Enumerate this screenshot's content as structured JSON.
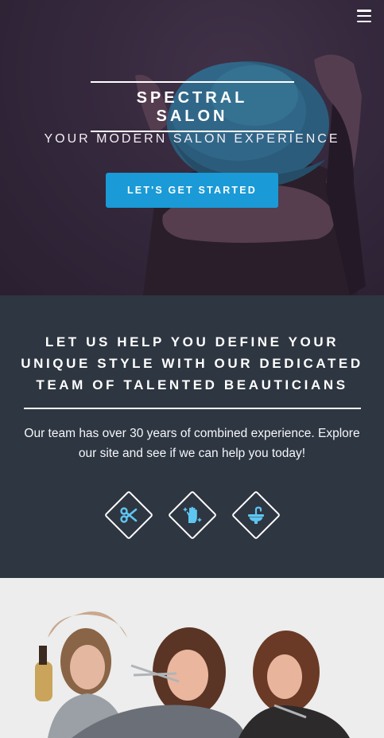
{
  "hero": {
    "title": "SPECTRAL SALON",
    "tagline": "YOUR MODERN SALON EXPERIENCE",
    "cta_label": "LET'S GET STARTED",
    "menu_icon": "hamburger-menu-icon"
  },
  "intro": {
    "heading": "LET US HELP YOU DEFINE YOUR UNIQUE STYLE WITH OUR DEDICATED TEAM OF TALENTED BEAUTICIANS",
    "body": "Our team has over 30 years of combined experience. Explore our site and see if we can help you today!",
    "services": [
      {
        "icon": "scissors-icon"
      },
      {
        "icon": "hand-sparkle-icon"
      },
      {
        "icon": "wash-sink-icon"
      }
    ]
  },
  "colors": {
    "accent": "#1a9ad6",
    "dark_panel": "#2e3641",
    "icon_blue": "#5fc6f2"
  }
}
